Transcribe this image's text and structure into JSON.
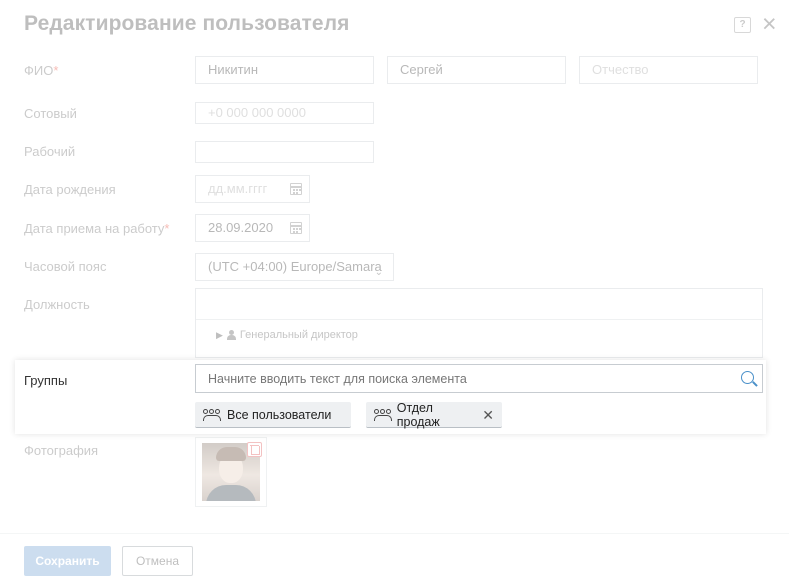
{
  "title": "Редактирование пользователя",
  "header": {
    "help_icon": "question-icon",
    "close_icon": "×"
  },
  "fio": {
    "label": "ФИО",
    "required_mark": "*",
    "last_name": "Никитин",
    "first_name": "Сергей",
    "middle_name_placeholder": "Отчество"
  },
  "mobile": {
    "label": "Сотовый",
    "placeholder": "+0 000 000 0000"
  },
  "work_phone": {
    "label": "Рабочий",
    "value": ""
  },
  "birth_date": {
    "label": "Дата рождения",
    "placeholder": "дд.мм.гггг"
  },
  "hire_date": {
    "label": "Дата приема на работу",
    "required_mark": "*",
    "value": "28.09.2020"
  },
  "timezone": {
    "label": "Часовой пояс",
    "value": "(UTC +04:00) Europe/Samara"
  },
  "position": {
    "label": "Должность",
    "tree_item": "Генеральный директор"
  },
  "groups": {
    "label": "Группы",
    "search_placeholder": "Начните вводить текст для поиска элемента",
    "chips": [
      {
        "label": "Все пользователи"
      },
      {
        "label": "Отдел продаж",
        "remove": "✕"
      }
    ]
  },
  "photo": {
    "label": "Фотография"
  },
  "footer": {
    "save_label": "Сохранить",
    "cancel_label": "Отмена"
  },
  "colors": {
    "accent": "#4a90c9",
    "save_button": "#7aa6d4",
    "required": "#e74c3c"
  }
}
